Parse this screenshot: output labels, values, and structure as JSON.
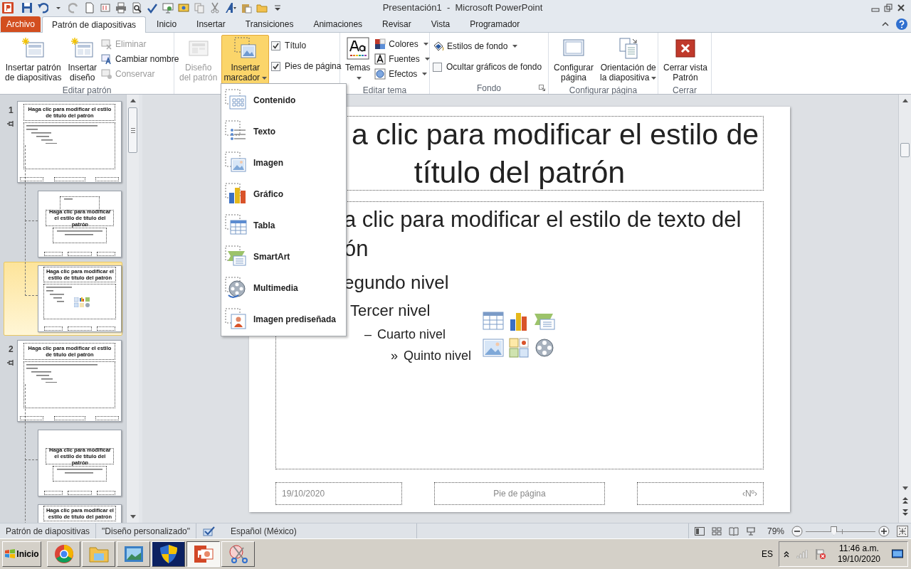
{
  "window": {
    "title": "Presentación1  -  Microsoft PowerPoint"
  },
  "tabs": [
    {
      "label": "Archivo",
      "kind": "file",
      "selected": false
    },
    {
      "label": "Patrón de diapositivas",
      "kind": "tab",
      "selected": true
    },
    {
      "label": "Inicio",
      "kind": "tab",
      "selected": false
    },
    {
      "label": "Insertar",
      "kind": "tab",
      "selected": false
    },
    {
      "label": "Transiciones",
      "kind": "tab",
      "selected": false
    },
    {
      "label": "Animaciones",
      "kind": "tab",
      "selected": false
    },
    {
      "label": "Revisar",
      "kind": "tab",
      "selected": false
    },
    {
      "label": "Vista",
      "kind": "tab",
      "selected": false
    },
    {
      "label": "Programador",
      "kind": "tab",
      "selected": false
    }
  ],
  "ribbon": {
    "groups": [
      {
        "label": "Editar patrón",
        "columns": [
          [
            {
              "kind": "large",
              "lines": [
                "Insertar patrón",
                "de diapositivas"
              ],
              "disabled": false
            }
          ],
          [
            {
              "kind": "large",
              "lines": [
                "Insertar",
                "diseño"
              ],
              "disabled": false
            }
          ],
          [
            {
              "kind": "small",
              "lines": [
                "Eliminar"
              ],
              "disabled": true
            },
            {
              "kind": "small",
              "lines": [
                "Cambiar nombre"
              ],
              "disabled": false
            },
            {
              "kind": "small",
              "lines": [
                "Conservar"
              ],
              "disabled": true
            }
          ]
        ]
      },
      {
        "columns": [
          [
            {
              "kind": "large",
              "lines": [
                "Diseño",
                "del patrón"
              ],
              "disabled": true
            }
          ],
          [
            {
              "kind": "large",
              "lines": [
                "Insertar",
                "marcador"
              ],
              "disabled": false,
              "menu": true,
              "expanded": true
            }
          ],
          [
            {
              "kind": "checkbox",
              "lines": [
                "Título"
              ],
              "checked": true
            },
            {
              "kind": "checkbox",
              "lines": [
                "Pies de página"
              ],
              "checked": true
            }
          ]
        ]
      },
      {
        "label": "Editar tema",
        "columns": [
          [
            {
              "kind": "large",
              "lines": [
                "Temas"
              ],
              "disabled": false,
              "menu": true,
              "expanded": false
            }
          ],
          [
            {
              "kind": "small",
              "lines": [
                "Colores"
              ],
              "disabled": false,
              "menu": true,
              "expanded": false
            },
            {
              "kind": "small",
              "lines": [
                "Fuentes"
              ],
              "disabled": false,
              "menu": true,
              "expanded": false
            },
            {
              "kind": "small",
              "lines": [
                "Efectos"
              ],
              "disabled": false,
              "menu": true,
              "expanded": false
            }
          ]
        ]
      },
      {
        "label": "Fondo",
        "dialog_launcher": true,
        "columns": [
          [
            {
              "kind": "small",
              "lines": [
                "Estilos de fondo"
              ],
              "disabled": false,
              "menu": true,
              "expanded": false
            },
            {
              "kind": "checkbox",
              "lines": [
                "Ocultar gráficos de fondo"
              ],
              "checked": false
            }
          ]
        ]
      },
      {
        "label": "Configurar página",
        "columns": [
          [
            {
              "kind": "large",
              "lines": [
                "Configurar",
                "página"
              ],
              "disabled": false
            }
          ],
          [
            {
              "kind": "large",
              "lines": [
                "Orientación de",
                "la diapositiva"
              ],
              "disabled": false,
              "menu": true,
              "expanded": false
            }
          ]
        ]
      },
      {
        "label": "Cerrar",
        "columns": [
          [
            {
              "kind": "large",
              "lines": [
                "Cerrar vista",
                "Patrón"
              ],
              "disabled": false
            }
          ]
        ]
      }
    ]
  },
  "placeholder_menu": {
    "items": [
      {
        "label": "Contenido"
      },
      {
        "label": "Texto"
      },
      {
        "label": "Imagen"
      },
      {
        "label": "Gráfico"
      },
      {
        "label": "Tabla"
      },
      {
        "label": "SmartArt"
      },
      {
        "label": "Multimedia"
      },
      {
        "label": "Imagen prediseñada"
      }
    ]
  },
  "thumbnails": [
    {
      "kind": "master",
      "number": "1",
      "selected": false,
      "title": "Haga clic para modificar el estilo de título del patrón"
    },
    {
      "kind": "picture_title",
      "selected": false,
      "title": "Haga  clic para modificar el estilo de título del patrón"
    },
    {
      "kind": "content",
      "selected": true,
      "title": "Haga  clic para modificar el estilo de título del patrón"
    },
    {
      "kind": "master",
      "number": "2",
      "selected": false,
      "title": "Haga clic para modificar el estilo de título del patrón"
    },
    {
      "kind": "title",
      "selected": false,
      "title": "Haga  clic para modificar el estilo de título del patrón"
    },
    {
      "kind": "content",
      "selected": false,
      "title": "Haga  clic para modificar el estilo de título del patrón"
    }
  ],
  "slide": {
    "title_lines": [
      "a clic para modificar el estilo de",
      "título del patrón"
    ],
    "body_lines": [
      {
        "text": "a clic para modificar el estilo de texto del"
      },
      {
        "text": "ón"
      },
      {
        "text": "egundo nivel"
      },
      {
        "text": "Tercer nivel"
      },
      {
        "bullet": "–",
        "text": "Cuarto nivel"
      },
      {
        "bullet": "»",
        "text": "Quinto nivel"
      }
    ],
    "footer": {
      "date": "19/10/2020",
      "text": "Pie de página",
      "number": "‹Nº›"
    }
  },
  "status_bar": {
    "items": [
      "Patrón de diapositivas",
      "\"Diseño personalizado\"",
      "Español (México)"
    ],
    "zoom": {
      "reading": "79%",
      "level": 0.4
    }
  },
  "taskbar": {
    "start": "Inicio",
    "apps": [
      {
        "kind": "browser",
        "selected": false
      },
      {
        "kind": "folder",
        "selected": false
      },
      {
        "kind": "photos",
        "selected": false
      },
      {
        "kind": "shield",
        "selected": false
      },
      {
        "kind": "powerpoint",
        "selected": true
      },
      {
        "kind": "snipping",
        "selected": false
      }
    ],
    "language": "ES",
    "time": "11:46 a.m.",
    "date": "19/10/2020"
  }
}
